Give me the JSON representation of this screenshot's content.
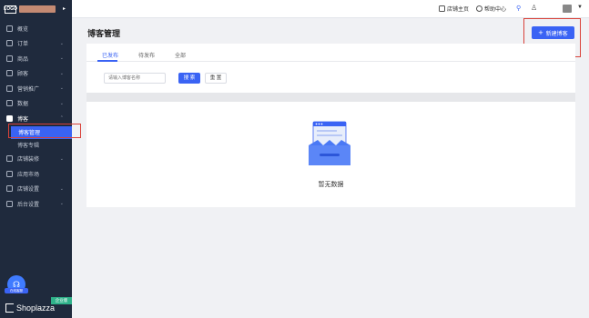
{
  "sidebar": {
    "logo_text": "LOGO",
    "items": [
      {
        "label": "概览",
        "icon": "home-icon",
        "chevron": ""
      },
      {
        "label": "订单",
        "icon": "order-icon",
        "chevron": "⌄"
      },
      {
        "label": "商品",
        "icon": "product-icon",
        "chevron": "⌄"
      },
      {
        "label": "顾客",
        "icon": "customer-icon",
        "chevron": "⌄"
      },
      {
        "label": "营销推广",
        "icon": "marketing-icon",
        "chevron": "⌄"
      },
      {
        "label": "数据",
        "icon": "data-icon",
        "chevron": "⌄"
      },
      {
        "label": "博客",
        "icon": "blog-icon",
        "chevron": "⌃"
      }
    ],
    "blog_sub": [
      {
        "label": "博客管理"
      },
      {
        "label": "博客专辑"
      }
    ],
    "items_after": [
      {
        "label": "店铺装修",
        "icon": "theme-icon",
        "chevron": "⌄"
      },
      {
        "label": "应用市场",
        "icon": "apps-icon",
        "chevron": ""
      },
      {
        "label": "店铺设置",
        "icon": "store-settings-icon",
        "chevron": "⌄"
      },
      {
        "label": "后台设置",
        "icon": "admin-settings-icon",
        "chevron": "⌄"
      }
    ],
    "help_label": "在线客服",
    "edition_badge": "企业版",
    "brand": "Shoplazza"
  },
  "topbar": {
    "store_home": "店铺主页",
    "help_center": "帮助中心"
  },
  "page": {
    "title": "博客管理",
    "new_button": "新建博客"
  },
  "tabs": [
    {
      "label": "已发布",
      "active": true
    },
    {
      "label": "待发布",
      "active": false
    },
    {
      "label": "全部",
      "active": false
    }
  ],
  "search": {
    "placeholder": "请输入博客名称",
    "search_label": "搜 索",
    "reset_label": "重 置"
  },
  "empty_state": {
    "text": "暂无数据"
  },
  "colors": {
    "sidebar_bg": "#1f2a3d",
    "accent": "#3a63f4",
    "highlight": "#d9423a",
    "badge": "#2fb28a"
  }
}
